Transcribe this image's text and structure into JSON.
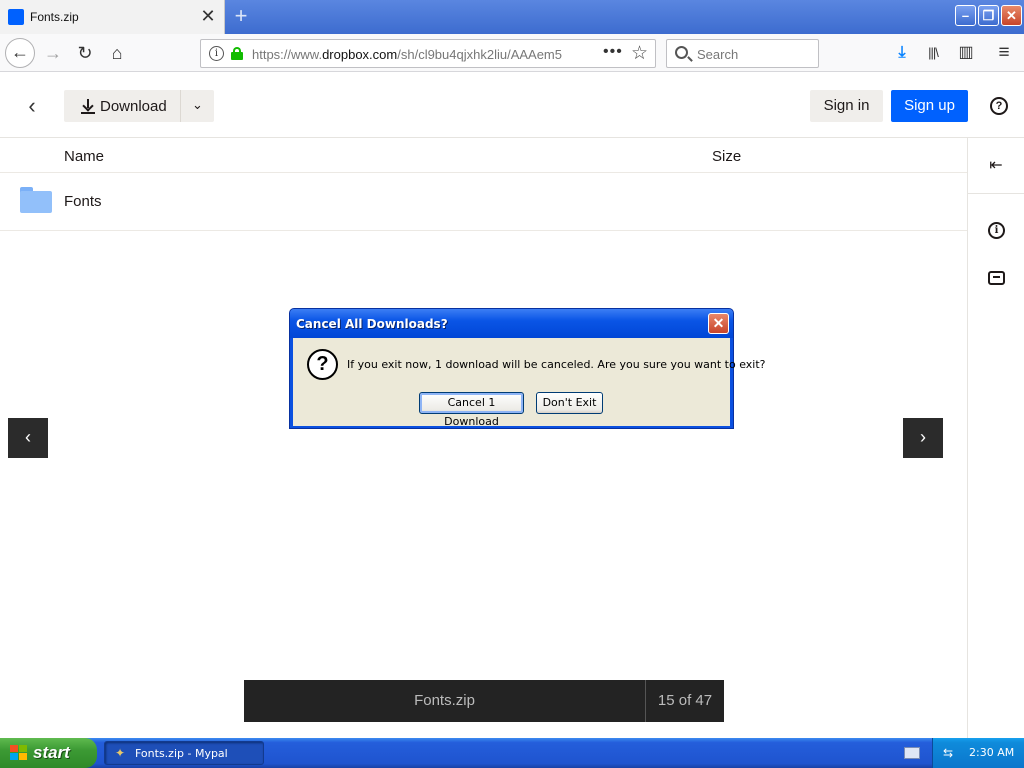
{
  "browser": {
    "tab_title": "Fonts.zip",
    "tab_close": "✕",
    "new_tab": "+",
    "url_prefix": "https://www.",
    "url_domain": "dropbox.com",
    "url_path": "/sh/cl9bu4qjxhk2liu/AAAem5",
    "search_placeholder": "Search",
    "window_controls": {
      "minimize": "–",
      "maximize": "❐",
      "close": "✕"
    },
    "nav": {
      "back": "←",
      "forward": "→",
      "reload": "↻",
      "home": "⌂"
    },
    "toolbar": {
      "downloads": "⤓",
      "library": "|||\\",
      "sidebar": "▥",
      "menu": "≡",
      "more": "•••",
      "bookmark": "☆"
    }
  },
  "page": {
    "header": {
      "back_glyph": "‹",
      "download_label": "Download",
      "download_caret": "⌄",
      "sign_in": "Sign in",
      "sign_up": "Sign up",
      "help": "?"
    },
    "table": {
      "columns": {
        "name": "Name",
        "size": "Size"
      },
      "rows": [
        {
          "name": "Fonts",
          "type": "folder"
        }
      ]
    },
    "sidebar": {
      "collapse": "⇤",
      "info": "i"
    },
    "preview_nav": {
      "prev": "‹",
      "next": "›"
    },
    "bottom_bar": {
      "file_name": "Fonts.zip",
      "position": "15 of 47"
    }
  },
  "dialog": {
    "title": "Cancel All Downloads?",
    "close": "✕",
    "icon": "?",
    "message": "If you exit now, 1 download will be canceled. Are you sure you want to exit?",
    "primary_button": "Cancel 1 Download",
    "secondary_button": "Don't Exit"
  },
  "taskbar": {
    "start_label": "start",
    "task_label": "Fonts.zip - Mypal",
    "time": "2:30 AM"
  },
  "colors": {
    "dropbox_blue": "#0061fe",
    "xp_taskbar_blue": "#245edb",
    "xp_start_green": "#3c9a34",
    "dialog_face": "#ece9d8",
    "lock_green": "#12bc00"
  }
}
